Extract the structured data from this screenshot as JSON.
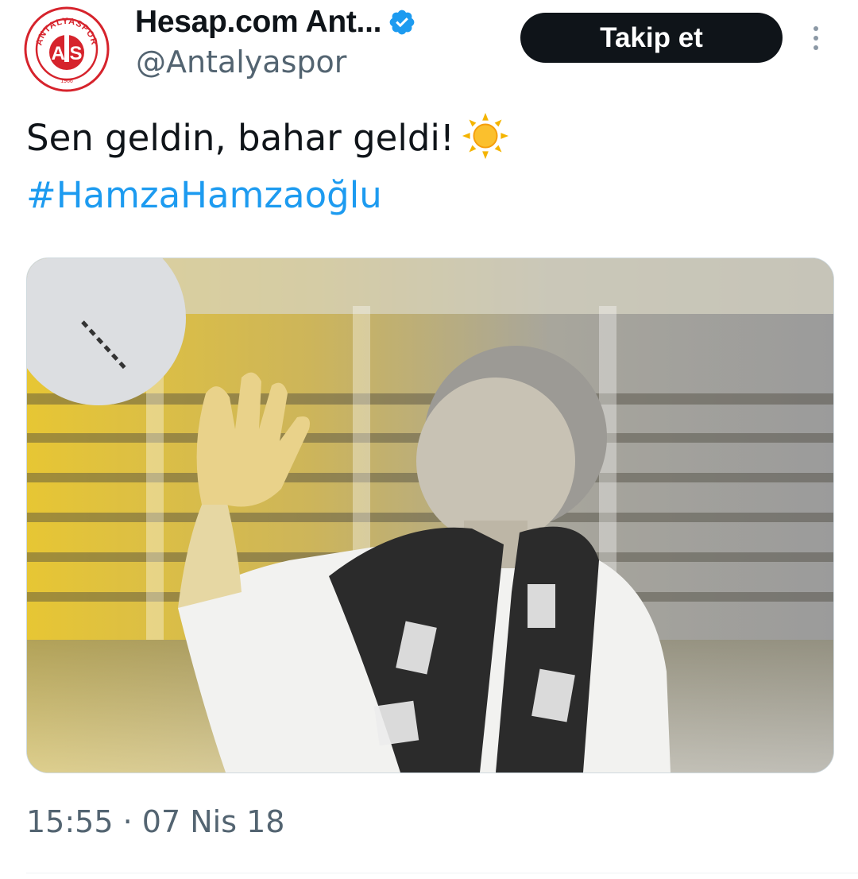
{
  "tweet": {
    "author": {
      "display_name": "Hesap.com Ant...",
      "handle": "@Antalyaspor",
      "verified": true,
      "avatar_icon": "antalyaspor-logo-icon",
      "avatar_text": "ANTALYASPOR",
      "avatar_year": "1966"
    },
    "follow_label": "Takip et",
    "text_line1": "Sen geldin, bahar geldi!",
    "emoji": "sun-icon",
    "hashtag": "#HamzaHamzaoğlu",
    "media": {
      "description": "photo-icon"
    },
    "time": "15:55",
    "separator": "·",
    "date": "07 Nis 18",
    "colors": {
      "text": "#0f1419",
      "secondary": "#536471",
      "link": "#1d9bf0",
      "verified": "#1d9bf0",
      "brand_red": "#d6232c",
      "button_bg": "#0f1419"
    }
  }
}
